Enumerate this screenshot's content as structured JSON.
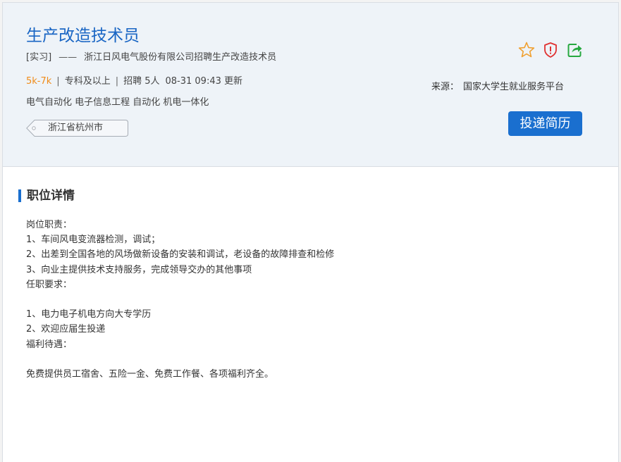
{
  "job": {
    "title": "生产改造技术员",
    "type_tag": "[实习]",
    "dash": "——",
    "company_line": "浙江日风电气股份有限公司招聘生产改造技术员",
    "salary": "5k-7k",
    "separator": "|",
    "education": "专科及以上",
    "recruit": "招聘 5人",
    "updated": "08-31 09:43 更新",
    "majors": "电气自动化 电子信息工程 自动化 机电一体化",
    "location": "浙江省杭州市"
  },
  "actions": {
    "favorite_icon": "star-icon",
    "report_icon": "shield-icon",
    "share_icon": "share-icon",
    "apply_label": "投递简历"
  },
  "source": {
    "label": "来源：",
    "value": "国家大学生就业服务平台"
  },
  "colors": {
    "title_blue": "#1a66c4",
    "salary_orange": "#f08c1a",
    "button_blue": "#1a6fcf",
    "header_bg": "#eef3f8",
    "star": "#f0a030",
    "shield": "#e03030",
    "share": "#27a840"
  },
  "detail": {
    "heading": "职位详情",
    "lines": [
      "岗位职责：",
      "1、车间风电变流器检测，调试；",
      "2、出差到全国各地的风场做新设备的安装和调试，老设备的故障排查和检修",
      "3、向业主提供技术支持服务，完成领导交办的其他事项",
      "任职要求：",
      "",
      "1、电力电子机电方向大专学历",
      "2、欢迎应届生投递",
      "福利待遇：",
      "",
      "免费提供员工宿舍、五险一金、免费工作餐、各项福利齐全。"
    ]
  }
}
